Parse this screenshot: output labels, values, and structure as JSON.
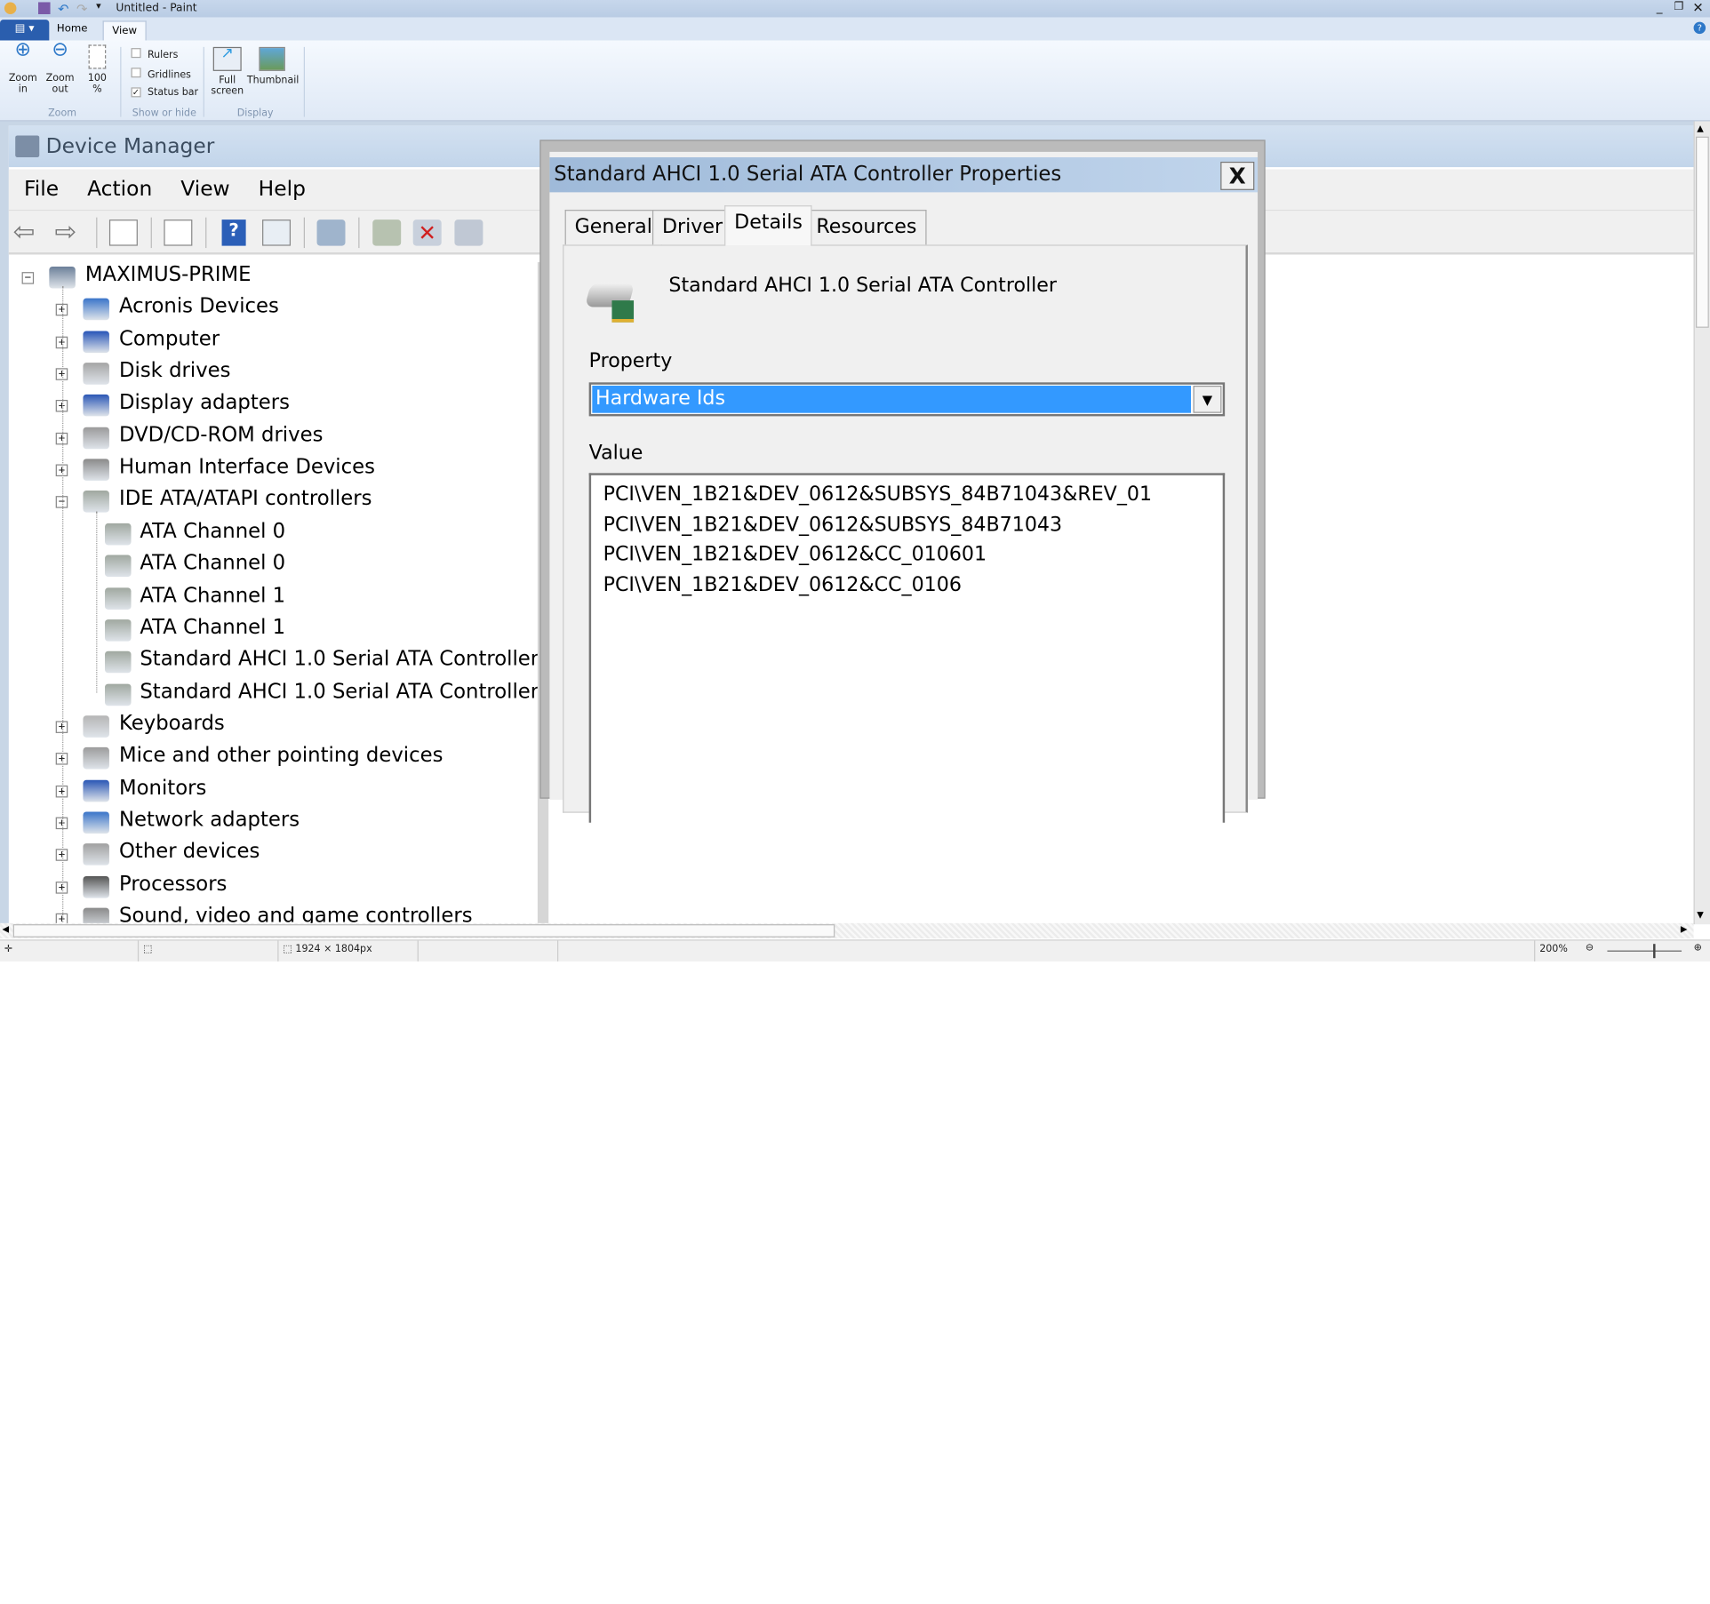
{
  "paint": {
    "window_title": "Untitled - Paint",
    "tabs": [
      {
        "label": "Home"
      },
      {
        "label": "View",
        "active": true
      }
    ],
    "zoom_group": {
      "label": "Zoom",
      "zoom_in": "Zoom in",
      "zoom_out": "Zoom out",
      "hundred": "100 %"
    },
    "show_group": {
      "label": "Show or hide",
      "rulers": {
        "label": "Rulers",
        "checked": false
      },
      "gridlines": {
        "label": "Gridlines",
        "checked": false
      },
      "status_bar": {
        "label": "Status bar",
        "checked": true
      }
    },
    "display_group": {
      "label": "Display",
      "full_screen": "Full screen",
      "thumbnail": "Thumbnail"
    },
    "status": {
      "dimensions": "1924 × 1804px",
      "zoom": "200%",
      "zoom_level_percent": 200
    }
  },
  "device_manager": {
    "title": "Device Manager",
    "menu": [
      "File",
      "Action",
      "View",
      "Help"
    ],
    "toolbar": [
      "back-icon",
      "forward-icon",
      "show-hide-console-tree-icon",
      "properties-icon",
      "help-icon",
      "action-pane-icon",
      "scan-hardware-icon",
      "update-driver-icon",
      "uninstall-icon",
      "disable-icon"
    ],
    "tree": [
      {
        "level": 0,
        "label": "MAXIMUS-PRIME",
        "expander": "−",
        "icon": "computer-icon",
        "color": "#6b7f99"
      },
      {
        "level": 1,
        "label": "Acronis Devices",
        "expander": "+",
        "icon": "network-icon",
        "color": "#3a74c9"
      },
      {
        "level": 1,
        "label": "Computer",
        "expander": "+",
        "icon": "computer-icon",
        "color": "#2855b8"
      },
      {
        "level": 1,
        "label": "Disk drives",
        "expander": "+",
        "icon": "disk-icon",
        "color": "#a5a5a5"
      },
      {
        "level": 1,
        "label": "Display adapters",
        "expander": "+",
        "icon": "display-icon",
        "color": "#2a56b5"
      },
      {
        "level": 1,
        "label": "DVD/CD-ROM drives",
        "expander": "+",
        "icon": "dvd-icon",
        "color": "#9a9a9a"
      },
      {
        "level": 1,
        "label": "Human Interface Devices",
        "expander": "+",
        "icon": "hid-icon",
        "color": "#8a8a8a"
      },
      {
        "level": 1,
        "label": "IDE ATA/ATAPI controllers",
        "expander": "−",
        "icon": "ide-controller-icon",
        "color": "#a0a8a0"
      },
      {
        "level": 2,
        "label": "ATA Channel 0",
        "icon": "ide-controller-icon",
        "color": "#a0a8a0"
      },
      {
        "level": 2,
        "label": "ATA Channel 0",
        "icon": "ide-controller-icon",
        "color": "#a0a8a0"
      },
      {
        "level": 2,
        "label": "ATA Channel 1",
        "icon": "ide-controller-icon",
        "color": "#a0a8a0"
      },
      {
        "level": 2,
        "label": "ATA Channel 1",
        "icon": "ide-controller-icon",
        "color": "#a0a8a0"
      },
      {
        "level": 2,
        "label": "Standard AHCI 1.0 Serial ATA Controller",
        "icon": "ide-controller-icon",
        "color": "#a0a8a0"
      },
      {
        "level": 2,
        "label": "Standard AHCI 1.0 Serial ATA Controller",
        "icon": "ide-controller-icon",
        "color": "#a0a8a0"
      },
      {
        "level": 1,
        "label": "Keyboards",
        "expander": "+",
        "icon": "keyboard-icon",
        "color": "#b5b5b5"
      },
      {
        "level": 1,
        "label": "Mice and other pointing devices",
        "expander": "+",
        "icon": "mouse-icon",
        "color": "#9c9c9c"
      },
      {
        "level": 1,
        "label": "Monitors",
        "expander": "+",
        "icon": "monitor-icon",
        "color": "#2a56b5"
      },
      {
        "level": 1,
        "label": "Network adapters",
        "expander": "+",
        "icon": "network-icon",
        "color": "#3a74c9"
      },
      {
        "level": 1,
        "label": "Other devices",
        "expander": "+",
        "icon": "unknown-device-icon",
        "color": "#a0a0a0"
      },
      {
        "level": 1,
        "label": "Processors",
        "expander": "+",
        "icon": "processor-icon",
        "color": "#555555"
      },
      {
        "level": 1,
        "label": "Sound, video and game controllers",
        "expander": "+",
        "icon": "sound-icon",
        "color": "#8a8a8a"
      }
    ]
  },
  "dialog": {
    "title": "Standard AHCI 1.0 Serial ATA Controller Properties",
    "close": "X",
    "tabs": [
      {
        "label": "General"
      },
      {
        "label": "Driver"
      },
      {
        "label": "Details",
        "active": true
      },
      {
        "label": "Resources"
      }
    ],
    "device_name": "Standard AHCI 1.0 Serial ATA Controller",
    "property_label": "Property",
    "property_value": "Hardware Ids",
    "value_label": "Value",
    "values": [
      "PCI\\VEN_1B21&DEV_0612&SUBSYS_84B71043&REV_01",
      "PCI\\VEN_1B21&DEV_0612&SUBSYS_84B71043",
      "PCI\\VEN_1B21&DEV_0612&CC_010601",
      "PCI\\VEN_1B21&DEV_0612&CC_0106"
    ],
    "selection_color": "#3399ff"
  }
}
